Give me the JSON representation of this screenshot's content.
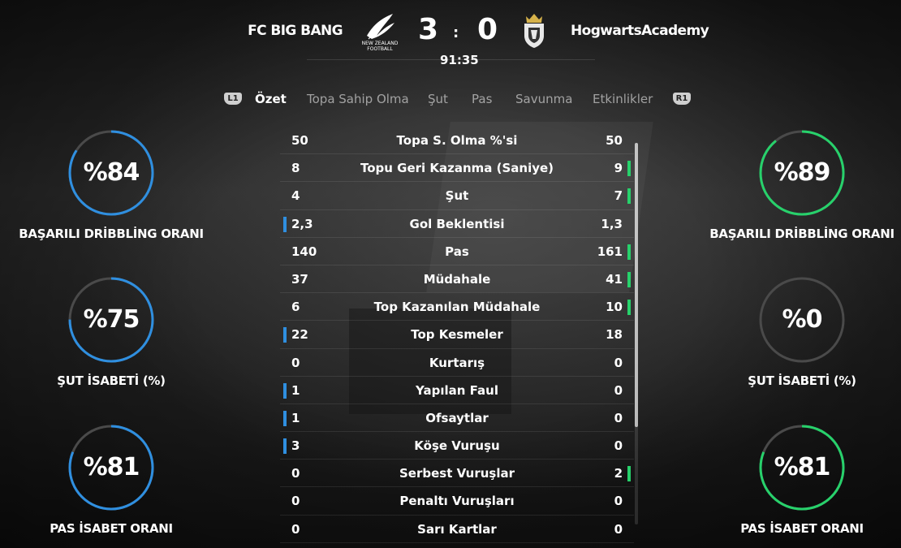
{
  "match": {
    "home_team": "FC BIG BANG",
    "away_team": "HogwartsAcademy",
    "home_score": "3",
    "separator": ":",
    "away_score": "0",
    "clock": "91:35",
    "home_badge_text_1": "NEW ZEALAND",
    "home_badge_text_2": "FOOTBALL"
  },
  "tabs": {
    "left_button": "L1",
    "right_button": "R1",
    "items": [
      "Özet",
      "Topa Sahip Olma",
      "Şut",
      "Pas",
      "Savunma",
      "Etkinlikler"
    ],
    "active": "Özet"
  },
  "colors": {
    "home_accent": "#2f8fe0",
    "away_accent": "#27d16b",
    "ring_track": "#4a4a4a"
  },
  "home_rings": [
    {
      "value": "%84",
      "percent": 84,
      "label": "BAŞARILI DRİBBLİNG ORANI"
    },
    {
      "value": "%75",
      "percent": 75,
      "label": "ŞUT İSABETİ (%)"
    },
    {
      "value": "%81",
      "percent": 81,
      "label": "PAS İSABET ORANI"
    }
  ],
  "away_rings": [
    {
      "value": "%89",
      "percent": 89,
      "label": "BAŞARILI DRİBBLİNG ORANI"
    },
    {
      "value": "%0",
      "percent": 0,
      "label": "ŞUT İSABETİ (%)"
    },
    {
      "value": "%81",
      "percent": 81,
      "label": "PAS İSABET ORANI"
    }
  ],
  "stats": [
    {
      "name": "Topa S. Olma %'si",
      "home": "50",
      "away": "50",
      "leader": "none"
    },
    {
      "name": "Topu Geri Kazanma (Saniye)",
      "home": "8",
      "away": "9",
      "leader": "away"
    },
    {
      "name": "Şut",
      "home": "4",
      "away": "7",
      "leader": "away"
    },
    {
      "name": "Gol Beklentisi",
      "home": "2,3",
      "away": "1,3",
      "leader": "home"
    },
    {
      "name": "Pas",
      "home": "140",
      "away": "161",
      "leader": "away"
    },
    {
      "name": "Müdahale",
      "home": "37",
      "away": "41",
      "leader": "away"
    },
    {
      "name": "Top Kazanılan Müdahale",
      "home": "6",
      "away": "10",
      "leader": "away"
    },
    {
      "name": "Top Kesmeler",
      "home": "22",
      "away": "18",
      "leader": "home"
    },
    {
      "name": "Kurtarış",
      "home": "0",
      "away": "0",
      "leader": "none"
    },
    {
      "name": "Yapılan Faul",
      "home": "1",
      "away": "0",
      "leader": "home"
    },
    {
      "name": "Ofsaytlar",
      "home": "1",
      "away": "0",
      "leader": "home"
    },
    {
      "name": "Köşe Vuruşu",
      "home": "3",
      "away": "0",
      "leader": "home"
    },
    {
      "name": "Serbest Vuruşlar",
      "home": "0",
      "away": "2",
      "leader": "away"
    },
    {
      "name": "Penaltı Vuruşları",
      "home": "0",
      "away": "0",
      "leader": "none"
    },
    {
      "name": "Sarı Kartlar",
      "home": "0",
      "away": "0",
      "leader": "none"
    }
  ]
}
